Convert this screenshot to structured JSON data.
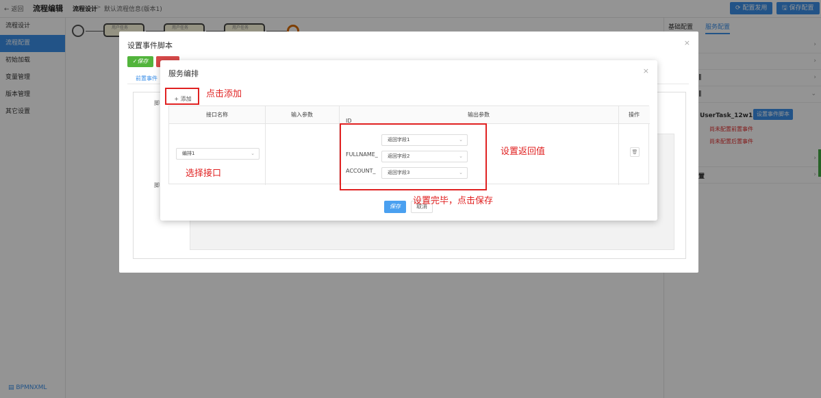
{
  "topbar": {
    "back": "← 返回",
    "title": "流程编辑",
    "crumb1": "流程设计",
    "sep": ">",
    "crumb2": "默认流程信息(版本1)",
    "btn_deploy": "⟳ 配置发用",
    "btn_save": "🖫 保存配置"
  },
  "sidebar": {
    "items": [
      "流程设计",
      "流程配置",
      "初始加载",
      "变量管理",
      "版本管理",
      "其它设置"
    ],
    "active_index": 1,
    "bottom": "▤ BPMNXML"
  },
  "canvas": {
    "tasks": [
      "用户任务",
      "用户任务",
      "用户任务"
    ]
  },
  "rightpanel": {
    "tab1": "基础配置",
    "tab2": "服务配置",
    "task_label": "UserTask_12w1iv2)",
    "task_btn": "设置事件脚本",
    "red1": "尚未配置前置事件",
    "red2": "尚未配置后置事件",
    "row_label_a": "‖",
    "row_label_b": "‖",
    "row_label_c": "置"
  },
  "dialog_event": {
    "title": "设置事件脚本",
    "save": "✓保存",
    "tab": "前置事件",
    "label1": "脚",
    "label2": "脚"
  },
  "dialog_service": {
    "title": "服务编排",
    "add": "+ 添加",
    "columns": [
      "接口名称",
      "输入参数",
      "输出参数",
      "操作"
    ],
    "interface_value": "编排1",
    "outputs": [
      {
        "field": "ID_",
        "value": "返回字段1"
      },
      {
        "field": "FULLNAME_",
        "value": "返回字段2"
      },
      {
        "field": "ACCOUNT_",
        "value": "返回字段3"
      }
    ],
    "delete_icon": "🗑",
    "save": "保存",
    "cancel": "取消"
  },
  "annotations": {
    "add": "点击添加",
    "select": "选择接口",
    "output": "设置返回值",
    "save": "设置完毕，点击保存"
  },
  "colors": {
    "primary": "#3b8fe8",
    "annotation_red": "#e02020",
    "save_green": "#52b43c"
  }
}
